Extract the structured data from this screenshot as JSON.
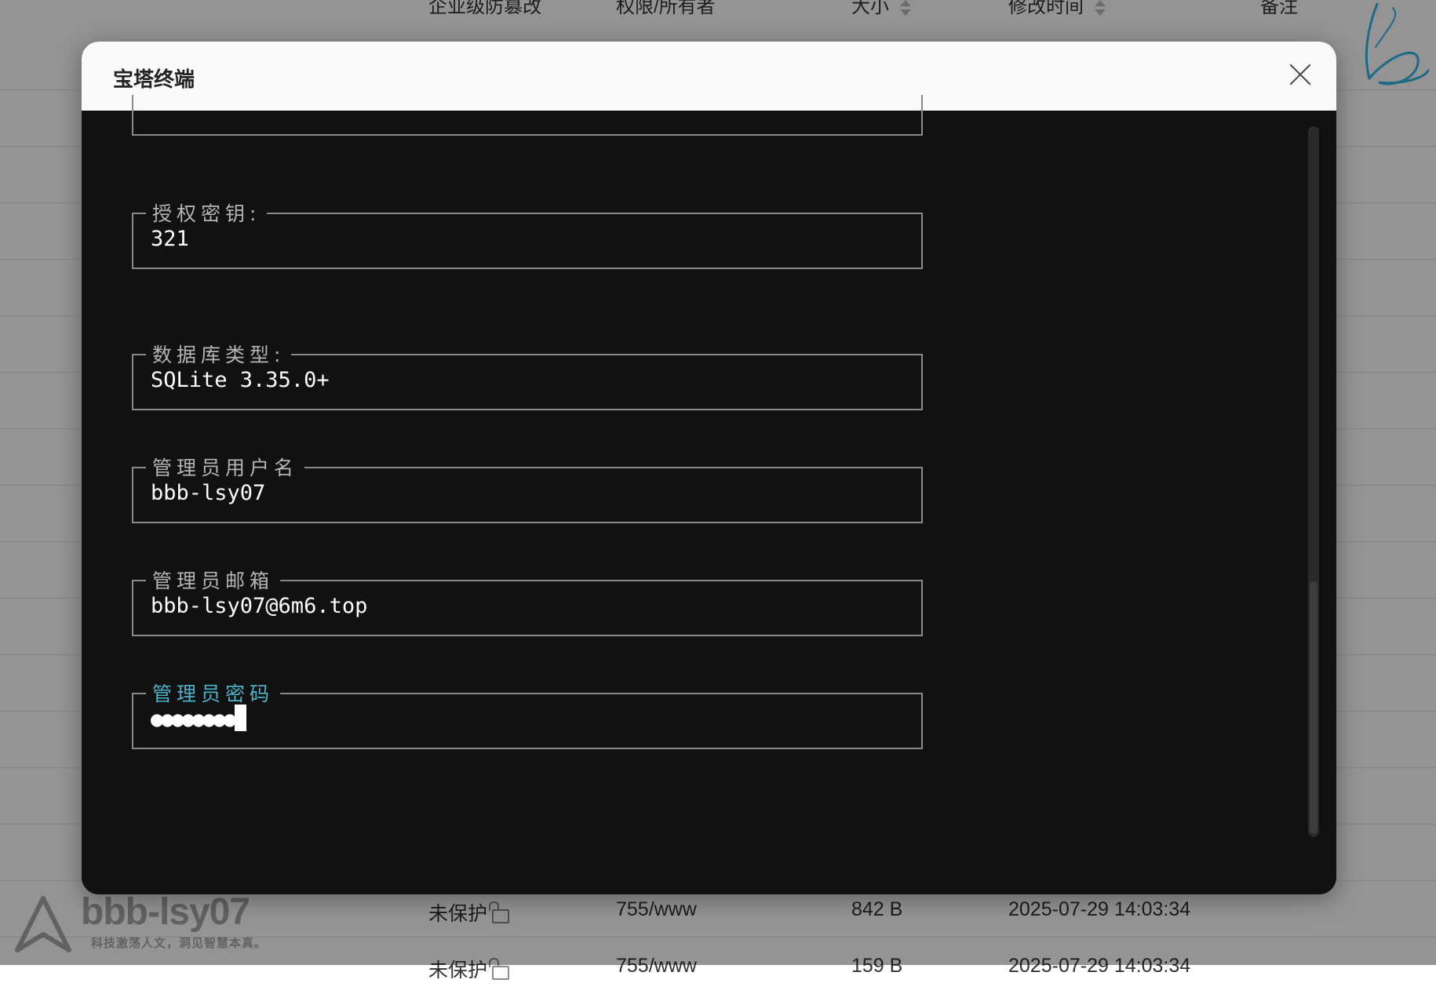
{
  "background": {
    "columns": {
      "protection": "企业级防篡改",
      "permission": "权限/所有者",
      "size": "大小",
      "modified": "修改时间",
      "note": "备注"
    },
    "rows": [
      {
        "protection": "未保护",
        "permission": "755/www",
        "size": "842 B",
        "modified": "2025-07-29 14:03:34"
      },
      {
        "protection": "未保护",
        "permission": "755/www",
        "size": "159 B",
        "modified": "2025-07-29 14:03:34"
      }
    ]
  },
  "watermark": {
    "name": "bbb-lsy07",
    "slogan": "科技激荡人文，洞见智慧本真。"
  },
  "modal": {
    "title": "宝塔终端",
    "fields": [
      {
        "label": "授权密钥:",
        "value": "321"
      },
      {
        "label": "数据库类型:",
        "value": "SQLite 3.35.0+"
      },
      {
        "label": "管理员用户名",
        "value": "bbb-lsy07"
      },
      {
        "label": "管理员邮箱",
        "value": "bbb-lsy07@6m6.top"
      },
      {
        "label": "管理员密码",
        "value": "●●●●●●●●"
      }
    ]
  },
  "colors": {
    "terminal_bg": "#111111",
    "active_label": "#4bb3c9",
    "field_border": "#8a8a8a"
  }
}
